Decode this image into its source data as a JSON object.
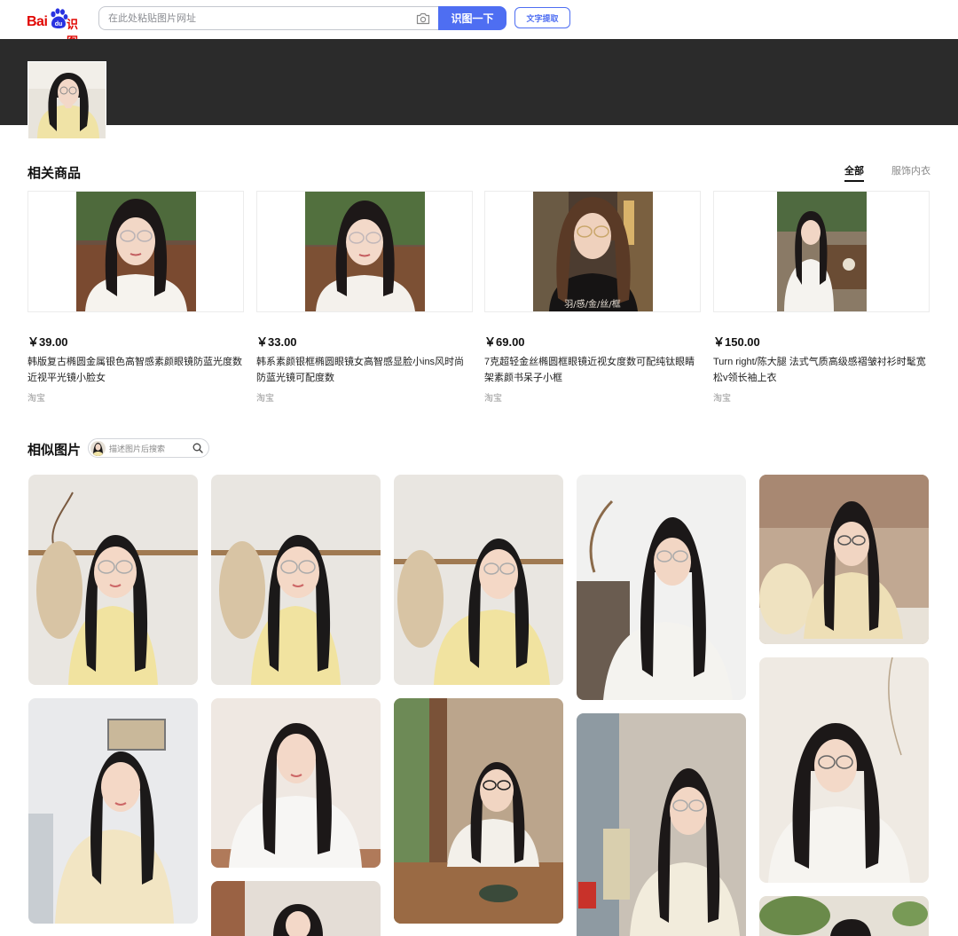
{
  "header": {
    "logo_text_bai": "Bai",
    "logo_text_du": "du",
    "logo_text_shitu": "识图",
    "search_placeholder": "在此处粘贴图片网址",
    "search_button": "识图一下",
    "ocr_button": "文字提取"
  },
  "products_section": {
    "title": "相关商品",
    "tabs": [
      "全部",
      "服饰内衣"
    ],
    "active_tab": "全部",
    "items": [
      {
        "price": "￥39.00",
        "title": "韩版复古椭圆金属银色高智感素颜眼镜防蓝光度数近视平光镜小脸女",
        "source": "淘宝"
      },
      {
        "price": "￥33.00",
        "title": "韩系素颜银框椭圆眼镜女高智感显脸小ins风时尚防蓝光镜可配度数",
        "source": "淘宝"
      },
      {
        "price": "￥69.00",
        "title": "7克超轻金丝椭圆框眼镜近视女度数可配纯钛眼睛架素颜书呆子小框",
        "source": "淘宝",
        "watermark": "羽/感/金/丝/框"
      },
      {
        "price": "￥150.00",
        "title": "Turn right/陈大腿 法式气质高级感褶皱衬衫时髦宽松v领长袖上衣",
        "source": "淘宝"
      }
    ]
  },
  "similar_section": {
    "title": "相似图片",
    "search_placeholder": "描述图片后搜索"
  },
  "colors": {
    "brand_red": "#e10602",
    "accent_blue": "#4e6ef2",
    "banner_dark": "#2b2b2b"
  },
  "icons": [
    "baidu-paw-icon",
    "camera-icon",
    "magnifier-icon"
  ]
}
